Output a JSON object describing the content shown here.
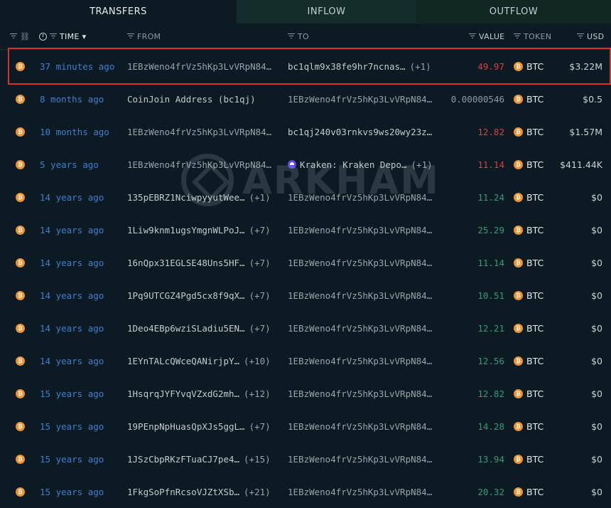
{
  "tabs": [
    {
      "label": "TRANSFERS"
    },
    {
      "label": "INFLOW"
    },
    {
      "label": "OUTFLOW"
    }
  ],
  "columns": {
    "time": "TIME",
    "from": "FROM",
    "to": "TO",
    "value": "VALUE",
    "token": "TOKEN",
    "usd": "USD",
    "time_sort_indicator": "▾"
  },
  "watermark": {
    "text": "ARKHAM"
  },
  "colors": {
    "outflow": "#d6413f",
    "inflow": "#2f9c75",
    "time_link": "#3f7fd1",
    "btc": "#f0922f",
    "highlight": "#d6322b"
  },
  "rows": [
    {
      "time": "37 minutes ago",
      "from": "1EBzWeno4frVz5hKp3LvVRpN84…",
      "from_extra": "",
      "to": "bc1qlm9x38fe9hr7ncnas…",
      "to_extra": "(+1)",
      "value": "49.97",
      "direction": "out",
      "token": "BTC",
      "usd": "$3.22M"
    },
    {
      "time": "8 months ago",
      "from": "CoinJoin Address (bc1qj)",
      "from_extra": "",
      "to": "1EBzWeno4frVz5hKp3LvVRpN84…",
      "to_extra": "",
      "value": "0.00000546",
      "direction": "neu",
      "token": "BTC",
      "usd": "$0.5"
    },
    {
      "time": "10 months ago",
      "from": "1EBzWeno4frVz5hKp3LvVRpN84…",
      "from_extra": "",
      "to": "bc1qj240v03rnkvs9ws20wy23z…",
      "to_extra": "",
      "value": "12.82",
      "direction": "out",
      "token": "BTC",
      "usd": "$1.57M"
    },
    {
      "time": "5 years ago",
      "from": "1EBzWeno4frVz5hKp3LvVRpN84…",
      "from_extra": "",
      "to": "Kraken: Kraken Depo…",
      "to_extra": "(+1)",
      "to_kraken": true,
      "value": "11.14",
      "direction": "out",
      "token": "BTC",
      "usd": "$411.44K"
    },
    {
      "time": "14 years ago",
      "from": "135pEBRZ1NciwpyyutWee…",
      "from_extra": "(+1)",
      "to": "1EBzWeno4frVz5hKp3LvVRpN84…",
      "to_extra": "",
      "value": "11.24",
      "direction": "in",
      "token": "BTC",
      "usd": "$0"
    },
    {
      "time": "14 years ago",
      "from": "1Liw9knm1ugsYmgnWLPoJ…",
      "from_extra": "(+7)",
      "to": "1EBzWeno4frVz5hKp3LvVRpN84…",
      "to_extra": "",
      "value": "25.29",
      "direction": "in",
      "token": "BTC",
      "usd": "$0"
    },
    {
      "time": "14 years ago",
      "from": "16nQpx31EGLSE48Uns5HF…",
      "from_extra": "(+7)",
      "to": "1EBzWeno4frVz5hKp3LvVRpN84…",
      "to_extra": "",
      "value": "11.14",
      "direction": "in",
      "token": "BTC",
      "usd": "$0"
    },
    {
      "time": "14 years ago",
      "from": "1Pq9UTCGZ4Pgd5cx8f9qX…",
      "from_extra": "(+7)",
      "to": "1EBzWeno4frVz5hKp3LvVRpN84…",
      "to_extra": "",
      "value": "10.51",
      "direction": "in",
      "token": "BTC",
      "usd": "$0"
    },
    {
      "time": "14 years ago",
      "from": "1Deo4EBp6wziSLadiu5EN…",
      "from_extra": "(+7)",
      "to": "1EBzWeno4frVz5hKp3LvVRpN84…",
      "to_extra": "",
      "value": "12.21",
      "direction": "in",
      "token": "BTC",
      "usd": "$0"
    },
    {
      "time": "14 years ago",
      "from": "1EYnTALcQWceQANirjpY…",
      "from_extra": "(+10)",
      "to": "1EBzWeno4frVz5hKp3LvVRpN84…",
      "to_extra": "",
      "value": "12.56",
      "direction": "in",
      "token": "BTC",
      "usd": "$0"
    },
    {
      "time": "15 years ago",
      "from": "1HsqrqJYFYvqVZxdG2mh…",
      "from_extra": "(+12)",
      "to": "1EBzWeno4frVz5hKp3LvVRpN84…",
      "to_extra": "",
      "value": "12.82",
      "direction": "in",
      "token": "BTC",
      "usd": "$0"
    },
    {
      "time": "15 years ago",
      "from": "19PEnpNpHuasQpXJs5ggL…",
      "from_extra": "(+7)",
      "to": "1EBzWeno4frVz5hKp3LvVRpN84…",
      "to_extra": "",
      "value": "14.28",
      "direction": "in",
      "token": "BTC",
      "usd": "$0"
    },
    {
      "time": "15 years ago",
      "from": "1JSzCbpRKzFTuaCJ7pe4…",
      "from_extra": "(+15)",
      "to": "1EBzWeno4frVz5hKp3LvVRpN84…",
      "to_extra": "",
      "value": "13.94",
      "direction": "in",
      "token": "BTC",
      "usd": "$0"
    },
    {
      "time": "15 years ago",
      "from": "1FkgSoPfnRcsoVJZtXSb…",
      "from_extra": "(+21)",
      "to": "1EBzWeno4frVz5hKp3LvVRpN84…",
      "to_extra": "",
      "value": "20.32",
      "direction": "in",
      "token": "BTC",
      "usd": "$0"
    }
  ]
}
